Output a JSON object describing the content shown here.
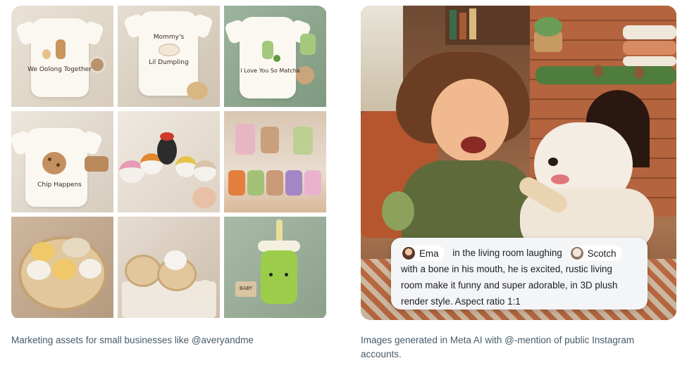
{
  "left_card": {
    "tiles": [
      {
        "label": "We Oolong Together"
      },
      {
        "label_line1": "Mommy's",
        "label_line2": "Lil Dumpling"
      },
      {
        "label": "I Love You So Matcha"
      },
      {
        "label": "Chip Happens"
      },
      {
        "label": ""
      },
      {
        "label": ""
      },
      {
        "label": ""
      },
      {
        "label": ""
      },
      {
        "label": "BABY"
      }
    ],
    "caption": "Marketing assets for small businesses like @averyandme"
  },
  "right_card": {
    "prompt": {
      "mention_1": "Ema",
      "text_1": "in the living room laughing",
      "mention_2": "Scotch",
      "line_2": "with a bone in his mouth, he is excited, rustic living",
      "line_3": "room make it funny and super adorable, in 3D plush",
      "line_4": "render style. Aspect ratio 1:1"
    },
    "caption_line1": "Images generated in Meta AI with @-mention of public Instagram",
    "caption_line2": "accounts."
  },
  "colors": {
    "caption_text": "#465a69",
    "prompt_bg": "#f4f5f7"
  }
}
